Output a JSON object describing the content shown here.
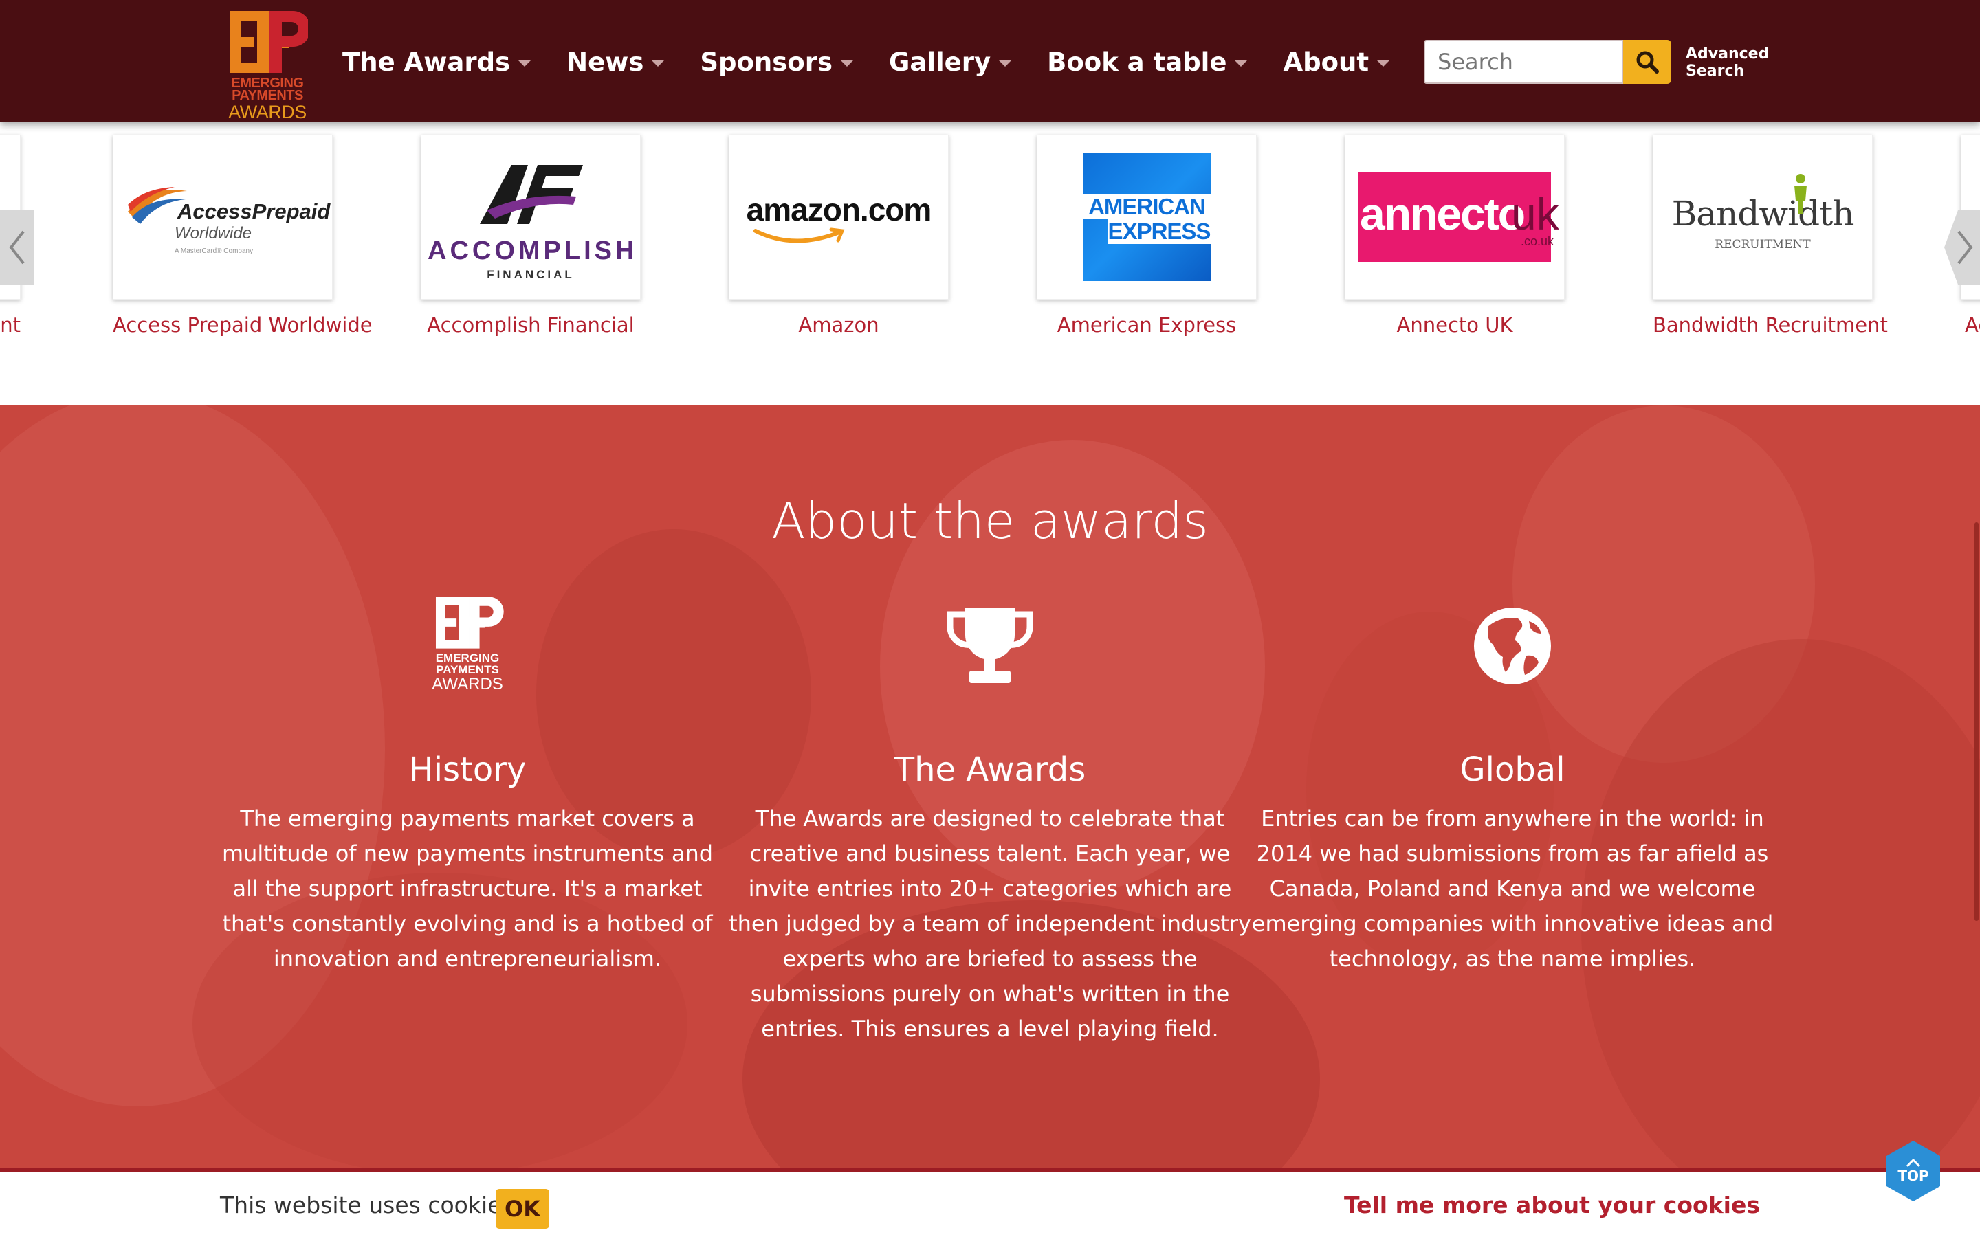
{
  "header": {
    "logo": {
      "mark": "E+P",
      "line1": "EMERGING",
      "line2": "PAYMENTS",
      "line3": "AWARDS"
    },
    "nav": [
      {
        "label": "The Awards",
        "icon": "chevron-down-icon"
      },
      {
        "label": "News",
        "icon": "chevron-down-icon"
      },
      {
        "label": "Sponsors",
        "icon": "chevron-down-icon"
      },
      {
        "label": "Gallery",
        "icon": "chevron-down-icon"
      },
      {
        "label": "Book a table",
        "icon": "chevron-down-icon"
      },
      {
        "label": "About",
        "icon": "chevron-down-icon"
      }
    ],
    "search": {
      "placeholder": "Search",
      "button_icon": "search-icon"
    },
    "advanced_search": {
      "line1": "Advanced",
      "line2": "Search"
    }
  },
  "sponsors": {
    "partial_left_label": "ent",
    "partial_right_label": "Acc",
    "items": [
      {
        "name": "Access Prepaid Worldwide",
        "logo_text": "AccessPrepaid",
        "logo_sub": "Worldwide",
        "logo_note": "A MasterCard® Company"
      },
      {
        "name": "Accomplish Financial",
        "logo_text": "ACCOMPLISH",
        "logo_sub": "FINANCIAL"
      },
      {
        "name": "Amazon",
        "logo_text": "amazon.com"
      },
      {
        "name": "American Express",
        "logo_text": "AMERICAN",
        "logo_sub": "EXPRESS"
      },
      {
        "name": "Annecto UK",
        "logo_text": "annecto",
        "logo_sub": "uk",
        "logo_note": ".co.uk"
      },
      {
        "name": "Bandwidth Recruitment",
        "logo_text": "Bandwidth",
        "logo_sub": "RECRUITMENT"
      }
    ],
    "prev_icon": "chevron-left-icon",
    "next_icon": "chevron-right-icon"
  },
  "about": {
    "title": "About the awards",
    "columns": [
      {
        "icon": "ep-awards-logo-icon",
        "icon_mark": "E+P",
        "icon_line1": "EMERGING",
        "icon_line2": "PAYMENTS",
        "icon_line3": "AWARDS",
        "heading": "History",
        "body": "The emerging payments market covers a multitude of new payments instruments and all the support infrastructure. It's a market that's constantly evolving and is a hotbed of innovation and entrepreneurialism."
      },
      {
        "icon": "trophy-icon",
        "heading": "The Awards",
        "body": "The Awards are designed to celebrate that creative and business talent. Each year, we invite entries into 20+ categories which are then judged by a team of independent industry experts who are briefed to assess the submissions purely on what's written in the entries. This ensures a level playing field."
      },
      {
        "icon": "globe-icon",
        "heading": "Global",
        "body": "Entries can be from anywhere in the world: in 2014 we had submissions from as far afield as Canada, Poland and Kenya and we welcome emerging companies with innovative ideas and technology, as the name implies."
      }
    ]
  },
  "cookie_bar": {
    "text": "This website uses cookies",
    "ok_label": "OK",
    "more_label": "Tell me more about your cookies"
  },
  "top_button": {
    "label": "TOP",
    "icon": "chevron-up-icon"
  },
  "colors": {
    "header_bg": "#4a0e12",
    "accent_yellow": "#f2b01e",
    "sponsor_link": "#b3202e",
    "about_bg": "#c8463e",
    "top_button": "#2b8fd6"
  }
}
